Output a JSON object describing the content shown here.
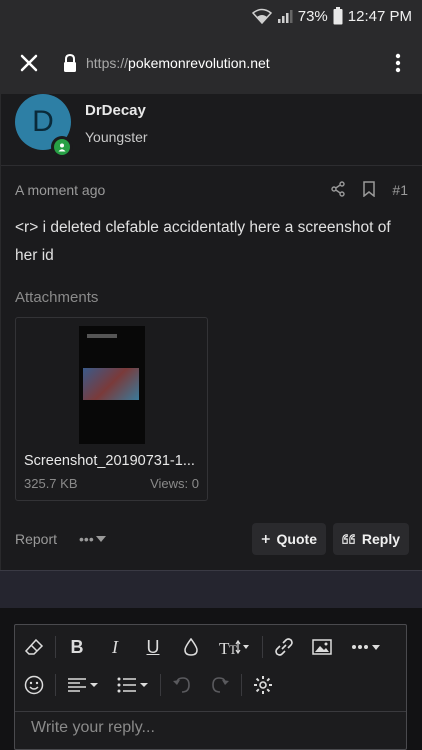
{
  "status_bar": {
    "battery": "73%",
    "time": "12:47 PM"
  },
  "browser": {
    "url_scheme": "https://",
    "url_domain": "pokemonrevolution.net"
  },
  "post": {
    "avatar_letter": "D",
    "username": "DrDecay",
    "user_title": "Youngster",
    "timestamp": "A moment ago",
    "post_number": "#1",
    "body": "<r> i deleted clefable accidentatly here a screenshot of her id",
    "attachments_label": "Attachments",
    "attachment": {
      "filename": "Screenshot_20190731-1...",
      "size": "325.7 KB",
      "views": "Views: 0"
    },
    "report_label": "Report",
    "more_label": "•••",
    "quote_label": "Quote",
    "reply_label": "Reply"
  },
  "editor": {
    "placeholder": "Write your reply..."
  }
}
